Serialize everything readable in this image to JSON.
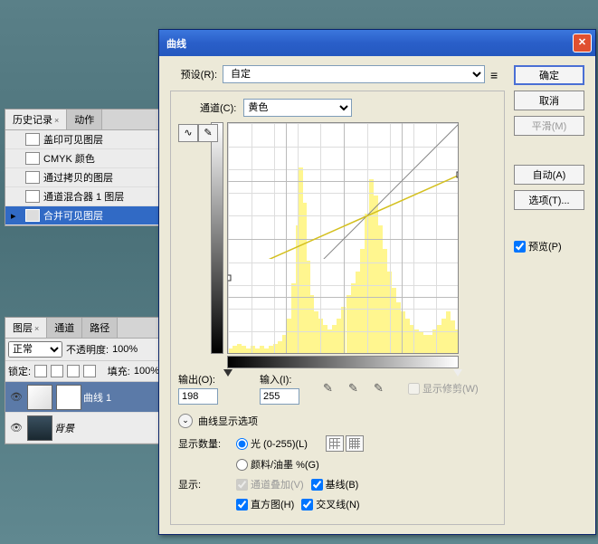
{
  "history": {
    "tab1": "历史记录",
    "tab2": "动作",
    "items": [
      "盖印可见图层",
      "CMYK 颜色",
      "通过拷贝的图层",
      "通道混合器 1 图层",
      "合并可见图层"
    ]
  },
  "layers": {
    "tab1": "图层",
    "tab2": "通道",
    "tab3": "路径",
    "blend": "正常",
    "opacity_label": "不透明度:",
    "opacity_value": "100%",
    "lock_label": "锁定:",
    "fill_label": "填充:",
    "fill_value": "100%",
    "layer1": "曲线 1",
    "layer2": "背景"
  },
  "dialog": {
    "title": "曲线",
    "preset_label": "预设(R):",
    "preset_value": "自定",
    "channel_label": "通道(C):",
    "channel_value": "黄色",
    "output_label": "输出(O):",
    "output_value": "198",
    "input_label": "输入(I):",
    "input_value": "255",
    "show_clip": "显示修剪(W)",
    "disp_opts_label": "曲线显示选项",
    "amount_label": "显示数量:",
    "amount_light": "光 (0-255)(L)",
    "amount_ink": "颜料/油墨 %(G)",
    "show_label": "显示:",
    "chan_overlay": "通道叠加(V)",
    "baseline": "基线(B)",
    "histogram": "直方图(H)",
    "intersect": "交叉线(N)",
    "ok": "确定",
    "cancel": "取消",
    "smooth": "平滑(M)",
    "auto": "自动(A)",
    "options": "选项(T)...",
    "preview": "预览(P)"
  },
  "chart_data": {
    "type": "line",
    "title": "曲线 — 黄色通道",
    "xlabel": "输入",
    "ylabel": "输出",
    "xlim": [
      0,
      255
    ],
    "ylim": [
      0,
      255
    ],
    "series": [
      {
        "name": "curve",
        "x": [
          0,
          255
        ],
        "y": [
          85,
          198
        ]
      },
      {
        "name": "baseline",
        "x": [
          0,
          255
        ],
        "y": [
          0,
          255
        ]
      }
    ],
    "points": [
      {
        "x": 0,
        "y": 85
      },
      {
        "x": 255,
        "y": 198
      }
    ],
    "histogram_approx": [
      {
        "x": 0,
        "h": 2
      },
      {
        "x": 5,
        "h": 3
      },
      {
        "x": 10,
        "h": 4
      },
      {
        "x": 15,
        "h": 3
      },
      {
        "x": 20,
        "h": 2
      },
      {
        "x": 25,
        "h": 3
      },
      {
        "x": 30,
        "h": 2
      },
      {
        "x": 35,
        "h": 3
      },
      {
        "x": 40,
        "h": 2
      },
      {
        "x": 45,
        "h": 3
      },
      {
        "x": 50,
        "h": 4
      },
      {
        "x": 55,
        "h": 5
      },
      {
        "x": 60,
        "h": 8
      },
      {
        "x": 65,
        "h": 15
      },
      {
        "x": 70,
        "h": 30
      },
      {
        "x": 75,
        "h": 55
      },
      {
        "x": 78,
        "h": 80
      },
      {
        "x": 82,
        "h": 65
      },
      {
        "x": 86,
        "h": 40
      },
      {
        "x": 90,
        "h": 25
      },
      {
        "x": 95,
        "h": 18
      },
      {
        "x": 100,
        "h": 15
      },
      {
        "x": 105,
        "h": 12
      },
      {
        "x": 110,
        "h": 10
      },
      {
        "x": 115,
        "h": 12
      },
      {
        "x": 120,
        "h": 15
      },
      {
        "x": 125,
        "h": 20
      },
      {
        "x": 130,
        "h": 25
      },
      {
        "x": 135,
        "h": 30
      },
      {
        "x": 140,
        "h": 35
      },
      {
        "x": 145,
        "h": 45
      },
      {
        "x": 150,
        "h": 60
      },
      {
        "x": 155,
        "h": 75
      },
      {
        "x": 160,
        "h": 68
      },
      {
        "x": 165,
        "h": 55
      },
      {
        "x": 170,
        "h": 45
      },
      {
        "x": 175,
        "h": 35
      },
      {
        "x": 180,
        "h": 28
      },
      {
        "x": 185,
        "h": 22
      },
      {
        "x": 190,
        "h": 18
      },
      {
        "x": 195,
        "h": 15
      },
      {
        "x": 200,
        "h": 12
      },
      {
        "x": 205,
        "h": 10
      },
      {
        "x": 210,
        "h": 9
      },
      {
        "x": 215,
        "h": 8
      },
      {
        "x": 220,
        "h": 8
      },
      {
        "x": 225,
        "h": 10
      },
      {
        "x": 230,
        "h": 12
      },
      {
        "x": 235,
        "h": 15
      },
      {
        "x": 240,
        "h": 18
      },
      {
        "x": 245,
        "h": 14
      },
      {
        "x": 250,
        "h": 10
      },
      {
        "x": 255,
        "h": 6
      }
    ]
  }
}
